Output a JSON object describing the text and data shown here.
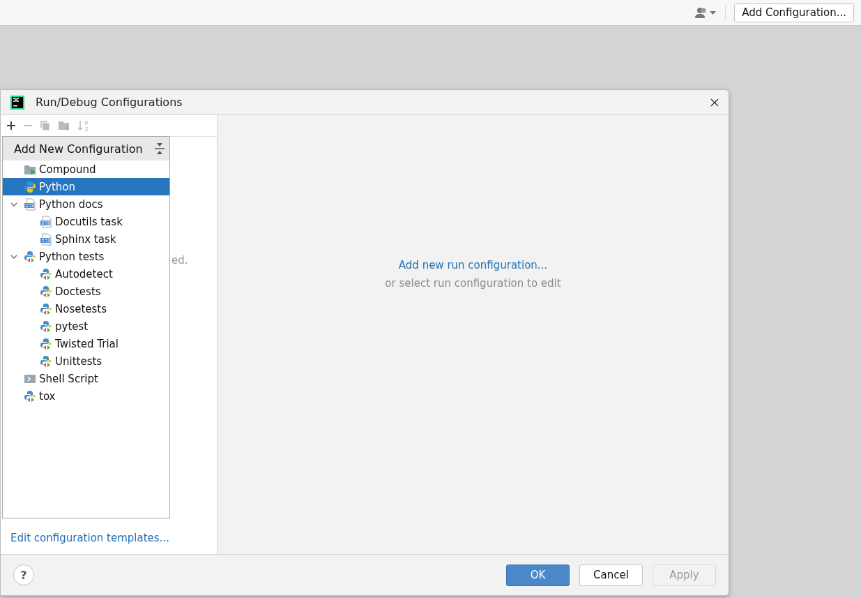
{
  "top_bar": {
    "button": "Add Configuration..."
  },
  "dialog": {
    "title": "Run/Debug Configurations",
    "left_panel": {
      "hidden_text": "ed.",
      "footer_link": "Edit configuration templates..."
    },
    "popup": {
      "title": "Add New Configuration",
      "items": [
        {
          "label": "Compound",
          "kind": "compound",
          "selected": false
        },
        {
          "label": "Python",
          "kind": "python",
          "selected": true
        },
        {
          "label": "Python docs",
          "kind": "rst",
          "selected": false,
          "expanded": true,
          "children": [
            {
              "label": "Docutils task",
              "kind": "rst",
              "selected": false
            },
            {
              "label": "Sphinx task",
              "kind": "rst",
              "selected": false
            }
          ]
        },
        {
          "label": "Python tests",
          "kind": "pytest",
          "selected": false,
          "expanded": true,
          "children": [
            {
              "label": "Autodetect",
              "kind": "pytest",
              "selected": false
            },
            {
              "label": "Doctests",
              "kind": "pytest",
              "selected": false
            },
            {
              "label": "Nosetests",
              "kind": "pytest",
              "selected": false
            },
            {
              "label": "pytest",
              "kind": "pytest",
              "selected": false
            },
            {
              "label": "Twisted Trial",
              "kind": "pytest",
              "selected": false
            },
            {
              "label": "Unittests",
              "kind": "pytest",
              "selected": false
            }
          ]
        },
        {
          "label": "Shell Script",
          "kind": "shell",
          "selected": false
        },
        {
          "label": "tox",
          "kind": "pytest",
          "selected": false
        }
      ]
    },
    "right_panel": {
      "link": "Add new run configuration...",
      "hint": "or select run configuration to edit"
    },
    "help_button": "?",
    "buttons": [
      {
        "label": "OK",
        "kind": "primary",
        "disabled": false
      },
      {
        "label": "Cancel",
        "kind": "normal",
        "disabled": false
      },
      {
        "label": "Apply",
        "kind": "normal",
        "disabled": true
      }
    ]
  }
}
